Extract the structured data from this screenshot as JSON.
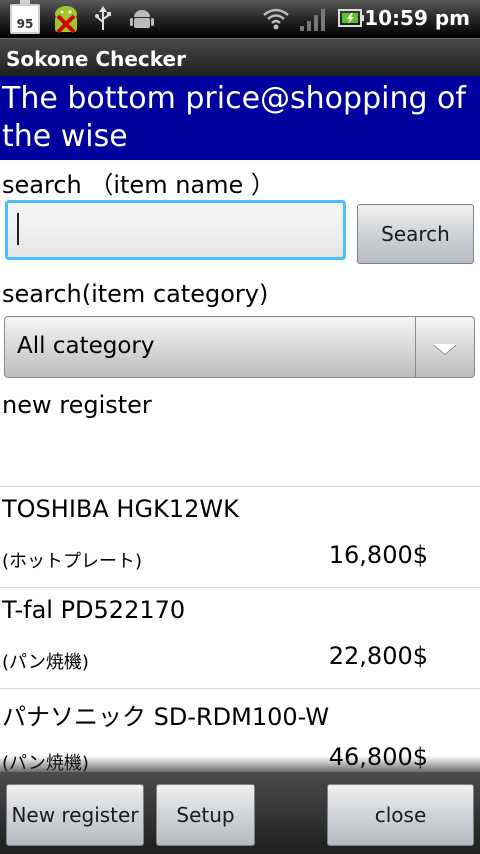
{
  "status_bar": {
    "battery_level": "95",
    "time": "10:59 pm",
    "icons": [
      "battery-icon",
      "android-debug-icon",
      "usb-icon",
      "android-icon",
      "wifi-icon",
      "signal-icon",
      "battery-charging-icon"
    ]
  },
  "app": {
    "title": "Sokone Checker"
  },
  "banner": {
    "line1": "The bottom price@shopping of",
    "line2": "the wise"
  },
  "search_name": {
    "label": "search （item name ）",
    "value": "",
    "button_label": "Search"
  },
  "search_category": {
    "label": "search(item category)",
    "selected": "All category"
  },
  "new_register_label": "new register",
  "items": [
    {
      "name": "TOSHIBA HGK12WK",
      "category": "(ホットプレート)",
      "price": "16,800$"
    },
    {
      "name": "T-fal PD522170",
      "category": "(パン焼機)",
      "price": "22,800$"
    },
    {
      "name": "パナソニック SD-RDM100-W",
      "category": "(パン焼機)",
      "price": "46,800$"
    }
  ],
  "bottom_bar": {
    "new_register": "New register",
    "setup": "Setup",
    "close": "close"
  }
}
